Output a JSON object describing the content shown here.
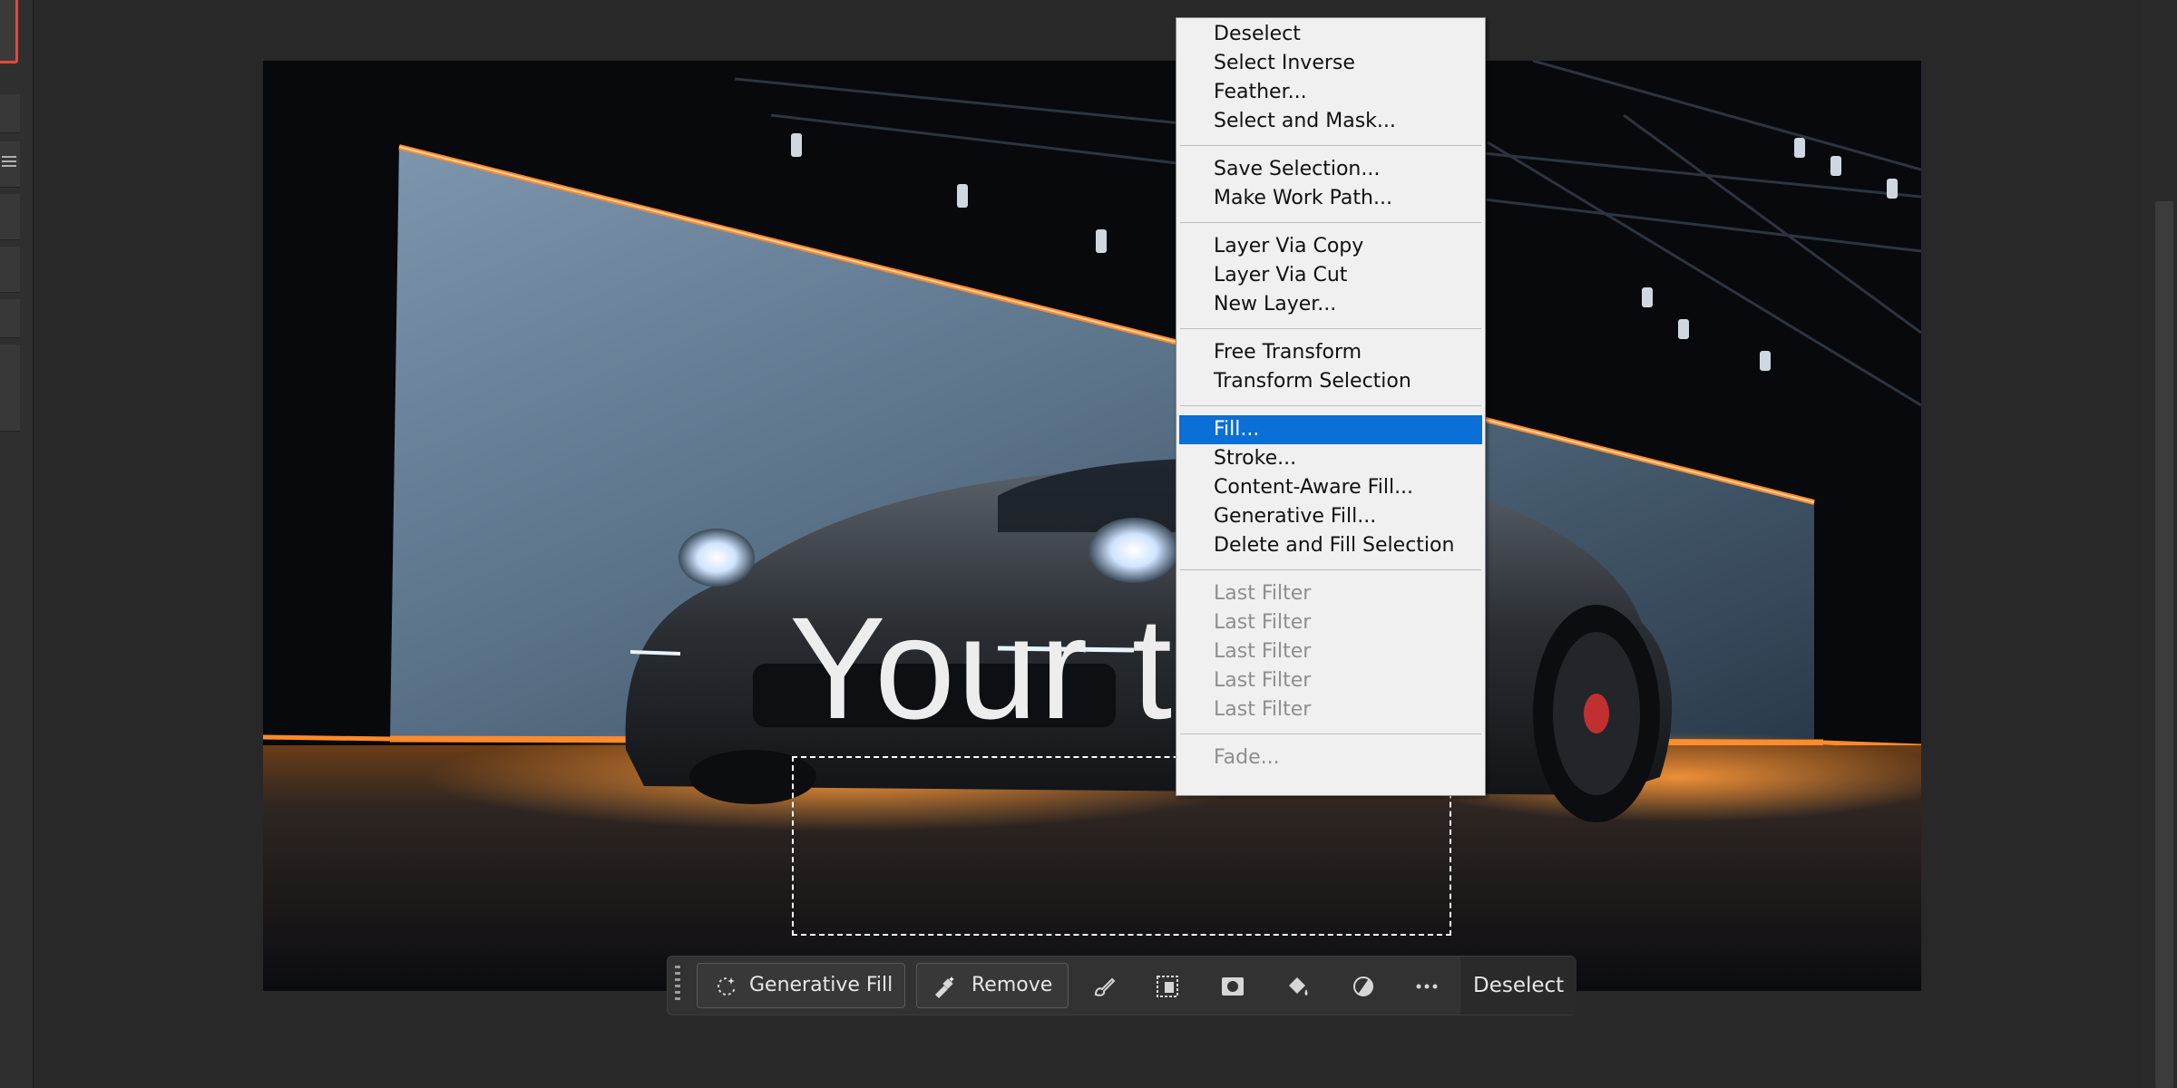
{
  "context_menu": {
    "items": [
      {
        "label": "Deselect"
      },
      {
        "label": "Select Inverse"
      },
      {
        "label": "Feather..."
      },
      {
        "label": "Select and Mask..."
      },
      {
        "label": "Save Selection..."
      },
      {
        "label": "Make Work Path..."
      },
      {
        "label": "Layer Via Copy"
      },
      {
        "label": "Layer Via Cut"
      },
      {
        "label": "New Layer..."
      },
      {
        "label": "Free Transform"
      },
      {
        "label": "Transform Selection"
      },
      {
        "label": "Fill..."
      },
      {
        "label": "Stroke..."
      },
      {
        "label": "Content-Aware Fill..."
      },
      {
        "label": "Generative Fill..."
      },
      {
        "label": "Delete and Fill Selection"
      },
      {
        "label": "Last Filter"
      },
      {
        "label": "Last Filter"
      },
      {
        "label": "Last Filter"
      },
      {
        "label": "Last Filter"
      },
      {
        "label": "Last Filter"
      },
      {
        "label": "Fade..."
      }
    ],
    "highlight_color": "#0a6fd7"
  },
  "canvas": {
    "overlay_text": "Your text"
  },
  "taskbar": {
    "generative_fill_label": "Generative Fill",
    "remove_label": "Remove",
    "deselect_label": "Deselect",
    "icons": [
      "brush-icon",
      "mask-icon",
      "layer-mask-icon",
      "fill-bucket-icon",
      "adjustment-icon",
      "more-icon"
    ]
  },
  "colors": {
    "selected_layer_outline": "#e8463c",
    "neon_orange": "#ff8a2a"
  }
}
